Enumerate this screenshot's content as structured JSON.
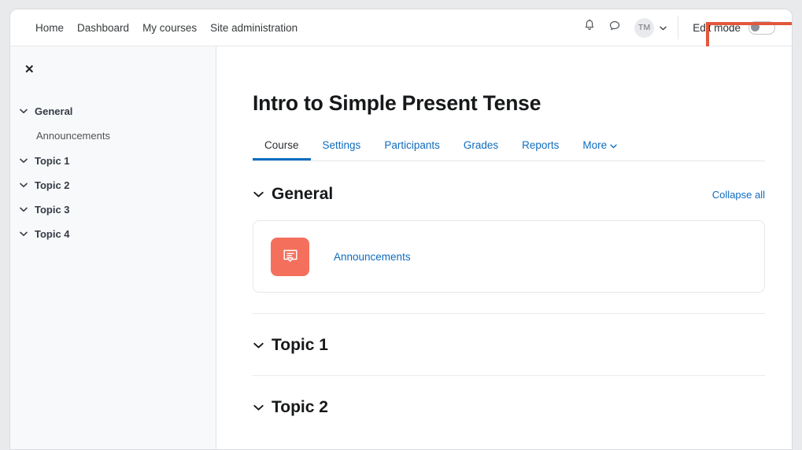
{
  "navbar": {
    "links": [
      {
        "label": "Home",
        "name": "nav-home"
      },
      {
        "label": "Dashboard",
        "name": "nav-dashboard"
      },
      {
        "label": "My courses",
        "name": "nav-my-courses"
      },
      {
        "label": "Site administration",
        "name": "nav-site-administration"
      }
    ],
    "notifications_icon": "bell-icon",
    "messages_icon": "message-bubble-icon",
    "avatar_initials": "TM",
    "user_menu_icon": "chevron-down-icon",
    "edit_mode": {
      "label": "Edit mode",
      "state": "off",
      "highlight_color": "#e2573c"
    }
  },
  "sidebar": {
    "close_icon": "close-icon",
    "items": [
      {
        "label": "General",
        "type": "section",
        "expanded": true,
        "name": "sidebar-item-general"
      },
      {
        "label": "Announcements",
        "type": "activity",
        "name": "sidebar-item-announcements"
      },
      {
        "label": "Topic 1",
        "type": "section",
        "expanded": true,
        "name": "sidebar-item-topic-1"
      },
      {
        "label": "Topic 2",
        "type": "section",
        "expanded": true,
        "name": "sidebar-item-topic-2"
      },
      {
        "label": "Topic 3",
        "type": "section",
        "expanded": true,
        "name": "sidebar-item-topic-3"
      },
      {
        "label": "Topic 4",
        "type": "section",
        "expanded": true,
        "name": "sidebar-item-topic-4"
      }
    ]
  },
  "main": {
    "course_title": "Intro to Simple Present Tense",
    "tabs": [
      {
        "label": "Course",
        "active": true
      },
      {
        "label": "Settings",
        "active": false
      },
      {
        "label": "Participants",
        "active": false
      },
      {
        "label": "Grades",
        "active": false
      },
      {
        "label": "Reports",
        "active": false
      },
      {
        "label": "More",
        "active": false,
        "has_dropdown": true
      }
    ],
    "sections": [
      {
        "title": "General",
        "collapse_all_label": "Collapse all",
        "activities": [
          {
            "name": "Announcements",
            "icon": "forum-icon",
            "icon_color": "#f4705c"
          }
        ]
      },
      {
        "title": "Topic 1",
        "activities": []
      },
      {
        "title": "Topic 2",
        "activities": []
      }
    ]
  },
  "colors": {
    "link_blue": "#0f6cbf",
    "forum_coral": "#f4705c",
    "annotation_red": "#e2573c",
    "sidebar_bg": "#f8f9fa"
  }
}
